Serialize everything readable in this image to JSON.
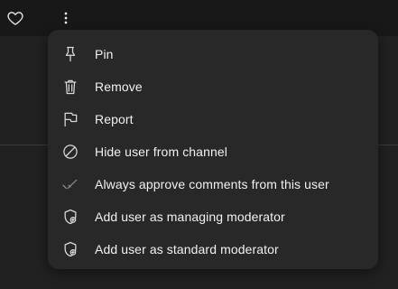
{
  "toolbar": {
    "like_icon": "heart-outline-icon",
    "more_icon": "more-vertical-icon"
  },
  "menu": {
    "items": [
      {
        "label": "Pin",
        "icon": "pin-icon"
      },
      {
        "label": "Remove",
        "icon": "trash-icon"
      },
      {
        "label": "Report",
        "icon": "flag-icon"
      },
      {
        "label": "Hide user from channel",
        "icon": "block-icon"
      },
      {
        "label": "Always approve comments from this user",
        "icon": "check-icon"
      },
      {
        "label": "Add user as managing moderator",
        "icon": "shield-add-icon"
      },
      {
        "label": "Add user as standard moderator",
        "icon": "shield-add-icon"
      }
    ]
  },
  "colors": {
    "page_background": "#212121",
    "topbar_background": "#181818",
    "menu_background": "#282828",
    "text": "#f1f1f1",
    "icon": "#d9d9d9"
  }
}
